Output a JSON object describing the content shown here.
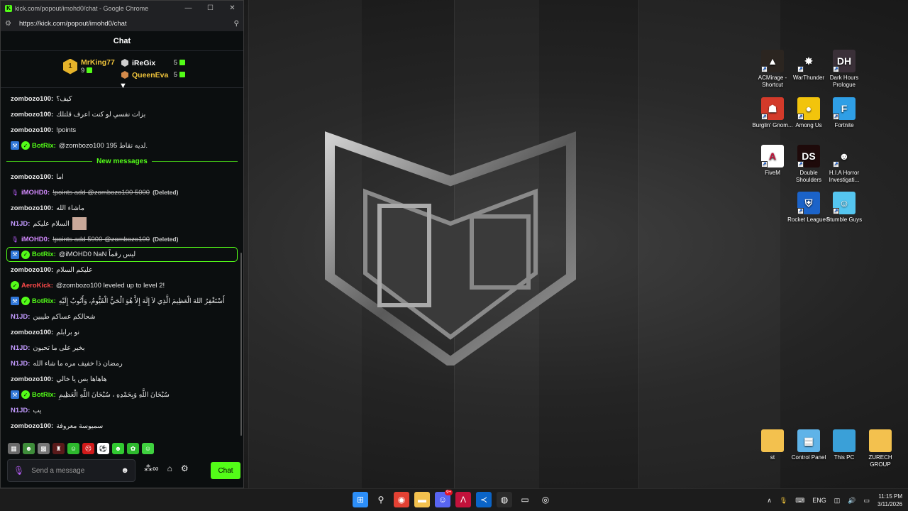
{
  "window": {
    "title": "kick.com/popout/imohd0/chat - Google Chrome",
    "url": "https://kick.com/popout/imohd0/chat"
  },
  "chat": {
    "header": "Chat",
    "leaderboard": {
      "first": {
        "rank": "1",
        "name": "MrKing77",
        "points": "9"
      },
      "others": [
        {
          "name": "iReGix",
          "points": "5",
          "color": "#ffffff"
        },
        {
          "name": "QueenEva",
          "points": "5",
          "color": "#f0c43b"
        }
      ]
    },
    "messages": [
      {
        "user": "zombozo100",
        "color": "#e8e8e8",
        "text": "كيف؟",
        "badges": []
      },
      {
        "user": "zombozo100",
        "color": "#e8e8e8",
        "text": "بزات نفسي لو كنت اعرف قلتلك",
        "badges": []
      },
      {
        "user": "zombozo100",
        "color": "#e8e8e8",
        "text": "!points",
        "badges": []
      },
      {
        "user": "BotRix",
        "color": "#53fc18",
        "text": "@zombozo100 195 لديه نقاط.",
        "badges": [
          "bot",
          "verified"
        ]
      }
    ],
    "separator": "New messages",
    "messages_new": [
      {
        "user": "zombozo100",
        "color": "#e8e8e8",
        "text": "اما",
        "badges": []
      },
      {
        "user": "iMOHD0",
        "color": "#d48bff",
        "text": "!points add @zombozo100 5000",
        "deleted": true,
        "deleted_label": "(Deleted)",
        "badges": [
          "broadcaster"
        ]
      },
      {
        "user": "zombozo100",
        "color": "#e8e8e8",
        "text": "ماشاء الله",
        "badges": []
      },
      {
        "user": "N1JD",
        "color": "#c39bff",
        "text": "السلام عليكم",
        "badges": [],
        "sticker": true
      },
      {
        "user": "iMOHD0",
        "color": "#d48bff",
        "text": "!points add 5000 @zombozo100",
        "deleted": true,
        "deleted_label": "(Deleted)",
        "badges": [
          "broadcaster"
        ]
      },
      {
        "user": "BotRix",
        "color": "#53fc18",
        "text": "@iMOHD0 NaN ليس رقماً",
        "badges": [
          "bot",
          "verified"
        ],
        "highlight": true
      },
      {
        "user": "zombozo100",
        "color": "#e8e8e8",
        "text": "عليكم السلام",
        "badges": []
      },
      {
        "user": "AeroKick",
        "color": "#ff4a4a",
        "text": "@zombozo100 leveled up to level 2!",
        "badges": [
          "verified"
        ]
      },
      {
        "user": "BotRix",
        "color": "#53fc18",
        "text": "أَسْتَغْفِرُ اللهَ الْعَظِيمَ الَّذِي لاَ إِلَهَ إِلاَّ هُوَ الْحَيُّ الْقَيُّومُ، وَأَتُوبُ إِلَيْهِ",
        "badges": [
          "bot",
          "verified"
        ]
      },
      {
        "user": "N1JD",
        "color": "#c39bff",
        "text": "شحالكم عساكم طيبين",
        "badges": []
      },
      {
        "user": "zombozo100",
        "color": "#e8e8e8",
        "text": "نو برابلم",
        "badges": []
      },
      {
        "user": "N1JD",
        "color": "#c39bff",
        "text": "بخير على ما تحبون",
        "badges": []
      },
      {
        "user": "N1JD",
        "color": "#c39bff",
        "text": "رمضان ذا خفيف مره ما شاء الله",
        "badges": []
      },
      {
        "user": "zombozo100",
        "color": "#e8e8e8",
        "text": "هاهاها بس يا خالي",
        "badges": []
      },
      {
        "user": "BotRix",
        "color": "#53fc18",
        "text": "سُبْحَانَ اللَّهِ وَبِحَمْدِهِ ، سُبْحَانَ اللَّهِ الْعَظِيمِ",
        "badges": [
          "bot",
          "verified"
        ]
      },
      {
        "user": "N1JD",
        "color": "#c39bff",
        "text": "يب",
        "badges": []
      },
      {
        "user": "zombozo100",
        "color": "#e8e8e8",
        "text": "سميوسة معروفة",
        "badges": []
      }
    ],
    "composer": {
      "placeholder": "Send a message",
      "send_label": "Chat",
      "infinity": "∞"
    }
  },
  "desktop_icons": [
    {
      "label": "ACMirage - Shortcut",
      "icon": "ac-mirage-icon",
      "bg": "#2b2520",
      "glyph": "▲"
    },
    {
      "label": "WarThunder",
      "icon": "war-thunder-icon",
      "bg": "transparent",
      "glyph": "✸"
    },
    {
      "label": "Dark Hours Prologue",
      "icon": "dark-hours-icon",
      "bg": "#3a3038",
      "glyph": "DH"
    },
    {
      "label": "Burglin' Gnom...",
      "icon": "burglin-gnomes-icon",
      "bg": "#d33a2a",
      "glyph": "☗"
    },
    {
      "label": "Among Us",
      "icon": "among-us-icon",
      "bg": "#f2c40c",
      "glyph": "●"
    },
    {
      "label": "Fortnite",
      "icon": "fortnite-icon",
      "bg": "#2f9fe6",
      "glyph": "F"
    },
    {
      "label": "FiveM",
      "icon": "fivem-icon",
      "bg": "#ffffff",
      "glyph": "A"
    },
    {
      "label": "Double Shoulders",
      "icon": "double-shoulders-icon",
      "bg": "#1e0a0a",
      "glyph": "DS"
    },
    {
      "label": "H.I.A Horror Investigati...",
      "icon": "hia-horror-icon",
      "bg": "transparent",
      "glyph": "☻"
    },
    {
      "label": "Rocket League®",
      "icon": "rocket-league-icon",
      "bg": "#1b63c9",
      "glyph": "⛨"
    },
    {
      "label": "Stumble Guys",
      "icon": "stumble-guys-icon",
      "bg": "#55c6f0",
      "glyph": "☺"
    },
    {
      "label": "st",
      "icon": "folder-icon",
      "bg": "#f3c14e",
      "glyph": ""
    },
    {
      "label": "Control Panel",
      "icon": "control-panel-icon",
      "bg": "#5fb3e8",
      "glyph": "▦"
    },
    {
      "label": "This PC",
      "icon": "this-pc-icon",
      "bg": "#3aa0d8",
      "glyph": ""
    },
    {
      "label": "ZURECH GROUP",
      "icon": "folder-icon",
      "bg": "#f3c14e",
      "glyph": ""
    }
  ],
  "taskbar": {
    "apps": [
      {
        "name": "start-icon",
        "bg": "#2c8ef8",
        "glyph": "⊞"
      },
      {
        "name": "search-icon",
        "bg": "transparent",
        "glyph": "⚲"
      },
      {
        "name": "chrome-icon",
        "bg": "#e34133",
        "glyph": "◉"
      },
      {
        "name": "file-explorer-icon",
        "bg": "#f3c14e",
        "glyph": "▬"
      },
      {
        "name": "discord-icon",
        "bg": "#5865f2",
        "glyph": "☺",
        "badge": "9+"
      },
      {
        "name": "app-red-icon",
        "bg": "#c3123b",
        "glyph": "Λ"
      },
      {
        "name": "vscode-icon",
        "bg": "#0a64c8",
        "glyph": "≺"
      },
      {
        "name": "obs-icon",
        "bg": "#2b2b2b",
        "glyph": "◍"
      },
      {
        "name": "kick-app-icon",
        "bg": "transparent",
        "glyph": "▭"
      },
      {
        "name": "app-circle-icon",
        "bg": "transparent",
        "glyph": "◎"
      }
    ],
    "lang": "ENG",
    "time": "11:15 PM",
    "date": "3/11/2026"
  }
}
